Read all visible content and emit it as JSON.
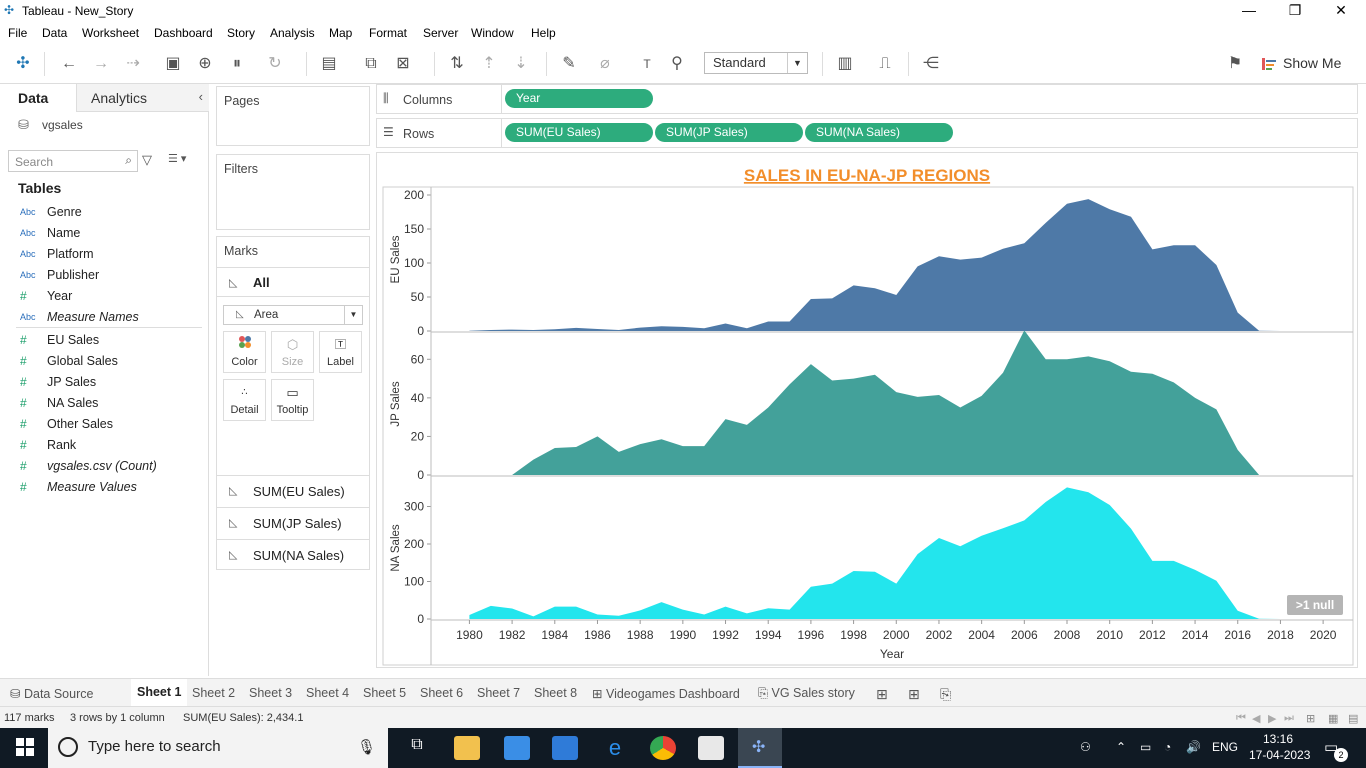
{
  "window": {
    "title": "Tableau - New_Story"
  },
  "menu": [
    "File",
    "Data",
    "Worksheet",
    "Dashboard",
    "Story",
    "Analysis",
    "Map",
    "Format",
    "Server",
    "Window",
    "Help"
  ],
  "toolbar": {
    "fit_value": "Standard",
    "show_me_label": "Show Me"
  },
  "left_panel": {
    "tab_data": "Data",
    "tab_analytics": "Analytics",
    "datasource": "vgsales",
    "search_placeholder": "Search",
    "tables_heading": "Tables",
    "fields": [
      {
        "type": "Abc",
        "name": "Genre"
      },
      {
        "type": "Abc",
        "name": "Name"
      },
      {
        "type": "Abc",
        "name": "Platform"
      },
      {
        "type": "Abc",
        "name": "Publisher"
      },
      {
        "type": "#",
        "name": "Year"
      },
      {
        "type": "Abc",
        "name": "Measure Names"
      },
      {
        "type": "#",
        "name": "EU Sales"
      },
      {
        "type": "#",
        "name": "Global Sales"
      },
      {
        "type": "#",
        "name": "JP Sales"
      },
      {
        "type": "#",
        "name": "NA Sales"
      },
      {
        "type": "#",
        "name": "Other Sales"
      },
      {
        "type": "#",
        "name": "Rank"
      },
      {
        "type": "#",
        "name": "vgsales.csv (Count)"
      },
      {
        "type": "#",
        "name": "Measure Values"
      }
    ]
  },
  "cards": {
    "pages": "Pages",
    "filters": "Filters",
    "marks": "Marks",
    "marks_all": "All",
    "mark_type": "Area",
    "buttons": {
      "color": "Color",
      "size": "Size",
      "label": "Label",
      "detail": "Detail",
      "tooltip": "Tooltip"
    },
    "measure_rows": [
      "SUM(EU Sales)",
      "SUM(JP Sales)",
      "SUM(NA Sales)"
    ]
  },
  "shelves": {
    "columns_label": "Columns",
    "rows_label": "Rows",
    "columns_pills": [
      "Year"
    ],
    "rows_pills": [
      "SUM(EU Sales)",
      "SUM(JP Sales)",
      "SUM(NA Sales)"
    ]
  },
  "null_badge": ">1 null",
  "chart_data": {
    "type": "area",
    "title": "SALES IN EU-NA-JP REGIONS",
    "xlabel": "Year",
    "x_ticks": [
      1980,
      1982,
      1984,
      1986,
      1988,
      1990,
      1992,
      1994,
      1996,
      1998,
      2000,
      2002,
      2004,
      2006,
      2008,
      2010,
      2012,
      2014,
      2016,
      2018,
      2020
    ],
    "x": [
      1980,
      1981,
      1982,
      1983,
      1984,
      1985,
      1986,
      1987,
      1988,
      1989,
      1990,
      1991,
      1992,
      1993,
      1994,
      1995,
      1996,
      1997,
      1998,
      1999,
      2000,
      2001,
      2002,
      2003,
      2004,
      2005,
      2006,
      2007,
      2008,
      2009,
      2010,
      2011,
      2012,
      2013,
      2014,
      2015,
      2016,
      2017,
      2018,
      2019,
      2020
    ],
    "series": [
      {
        "name": "EU Sales",
        "ylabel": "EU Sales",
        "color": "#4e79a7",
        "ylim": [
          0,
          200
        ],
        "yticks": [
          0,
          50,
          100,
          150,
          200
        ],
        "values": [
          0.5,
          1.5,
          2,
          1.5,
          2.5,
          4.5,
          3,
          1.5,
          5,
          7,
          6,
          4,
          11,
          4,
          14,
          14,
          47,
          48,
          67,
          63,
          53,
          95,
          110,
          105,
          108,
          121,
          129,
          159,
          187,
          194,
          179,
          168,
          120,
          126,
          126,
          97,
          27,
          0.3,
          0,
          0,
          0
        ]
      },
      {
        "name": "JP Sales",
        "ylabel": "JP Sales",
        "color": "#43a19a",
        "ylim": [
          0,
          70
        ],
        "yticks": [
          0,
          20,
          40,
          60
        ],
        "values": [
          0,
          0,
          0,
          8,
          14,
          14.5,
          20,
          12,
          16,
          18.5,
          15,
          15,
          29,
          26,
          35,
          47,
          57.5,
          49,
          50,
          52,
          43,
          40.5,
          41.5,
          35,
          41,
          53,
          75,
          60,
          60,
          61.5,
          59,
          53.5,
          52.5,
          48,
          40,
          34,
          13,
          0,
          0,
          0,
          0
        ]
      },
      {
        "name": "NA Sales",
        "ylabel": "NA Sales",
        "color": "#23e5ed",
        "ylim": [
          0,
          360
        ],
        "yticks": [
          0,
          100,
          200,
          300
        ],
        "values": [
          10.6,
          35,
          28,
          7,
          33,
          33,
          12,
          8.5,
          23,
          45,
          25,
          12,
          33,
          15,
          28.5,
          25,
          86,
          94.5,
          128,
          126,
          94.5,
          173,
          216,
          194,
          222,
          242,
          263,
          312,
          351,
          338,
          304,
          241,
          155,
          155,
          131,
          102,
          22,
          0.5,
          0,
          0,
          0
        ]
      }
    ]
  },
  "sheet_tabs": {
    "data_source": "Data Source",
    "sheets": [
      "Sheet 1",
      "Sheet 2",
      "Sheet 3",
      "Sheet 4",
      "Sheet 5",
      "Sheet 6",
      "Sheet 7",
      "Sheet 8"
    ],
    "dashboard": "Videogames Dashboard",
    "story": "VG Sales story"
  },
  "status": {
    "marks": "117 marks",
    "rows_cols": "3 rows by 1 column",
    "sum": "SUM(EU Sales): 2,434.1"
  },
  "taskbar": {
    "search_placeholder": "Type here to search",
    "lang": "ENG",
    "time": "13:16",
    "date": "17-04-2023",
    "notifications": "2"
  }
}
